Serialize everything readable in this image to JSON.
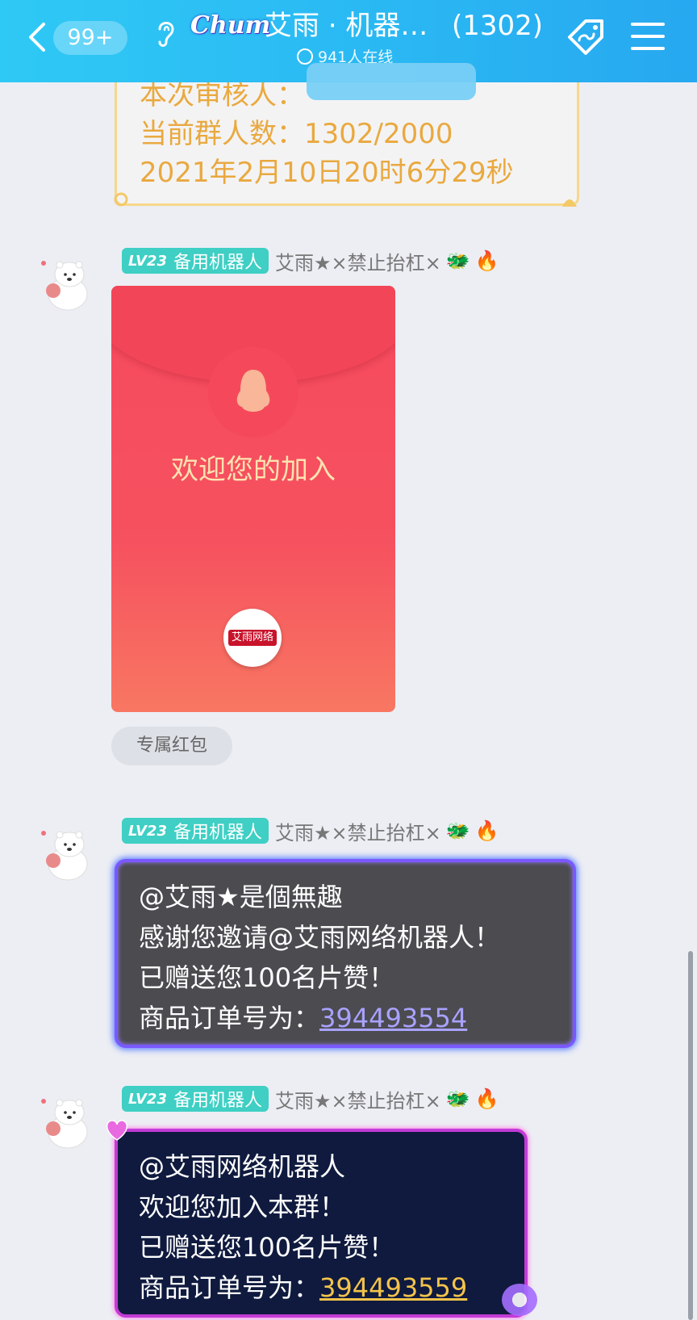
{
  "header": {
    "unread_badge": "99+",
    "logo_text": "Chum",
    "title": "艾雨 · 机器…",
    "member_count": "(1302)",
    "online_text": "941人在线"
  },
  "system_card": {
    "line1": "本次审核人：",
    "line2": "当前群人数：1302/2000",
    "line3": "2021年2月10日20时6分29秒"
  },
  "messages": [
    {
      "level": "LV23",
      "role": "备用机器人",
      "nickname": "艾雨★×禁止抬杠×",
      "type": "red_envelope",
      "envelope_text": "欢迎您的加入",
      "envelope_logo": "艾雨网络",
      "envelope_label": "专属红包"
    },
    {
      "level": "LV23",
      "role": "备用机器人",
      "nickname": "艾雨★×禁止抬杠×",
      "type": "text",
      "lines": [
        "@艾雨★是個無趣",
        "感谢您邀请@艾雨网络机器人！",
        "已赠送您100名片赞！"
      ],
      "order_prefix": "商品订单号为：",
      "order_number": "394493554"
    },
    {
      "level": "LV23",
      "role": "备用机器人",
      "nickname": "艾雨★×禁止抬杠×",
      "type": "text",
      "lines": [
        "@艾雨网络机器人",
        "欢迎您加入本群！",
        "已赠送您100名片赞！"
      ],
      "order_prefix": "商品订单号为：",
      "order_number": "394493559"
    }
  ],
  "icons": {
    "nick_badges": [
      "dragon-icon",
      "flame-icon"
    ],
    "avatar": "polar-bear-avatar"
  },
  "colors": {
    "header_accent": "#2ab8f3",
    "level_badge": "#3fcfc4",
    "system_text": "#e9a93f",
    "envelope_red": "#f54a5e"
  }
}
